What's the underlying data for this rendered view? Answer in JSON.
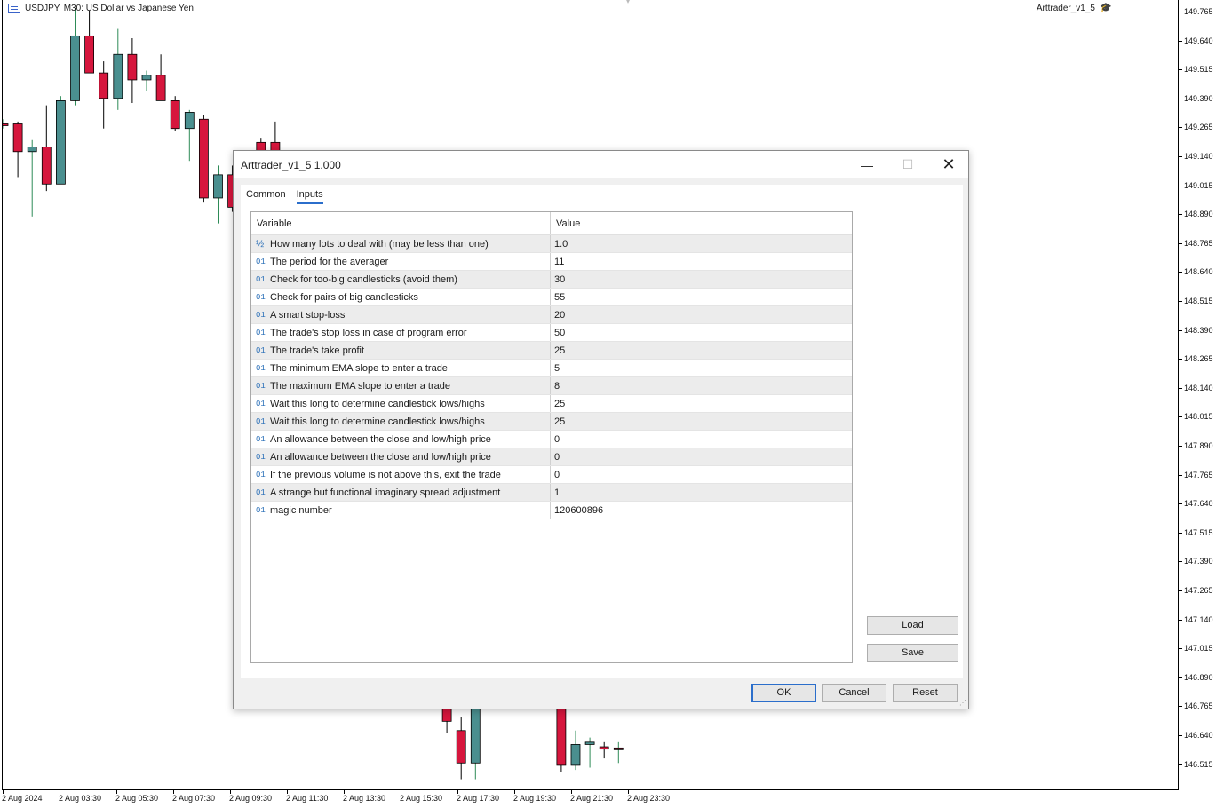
{
  "chart": {
    "symbol_text": "USDJPY, M30:  US Dollar vs Japanese Yen",
    "ea_name": "Arttrader_v1_5",
    "price_labels": [
      "149.765",
      "149.640",
      "149.515",
      "149.390",
      "149.265",
      "149.140",
      "149.015",
      "148.890",
      "148.765",
      "148.640",
      "148.515",
      "148.390",
      "148.265",
      "148.140",
      "148.015",
      "147.890",
      "147.765",
      "147.640",
      "147.515",
      "147.390",
      "147.265",
      "147.140",
      "147.015",
      "146.890",
      "146.765",
      "146.640",
      "146.515"
    ],
    "time_labels": [
      "2 Aug 2024",
      "2 Aug 03:30",
      "2 Aug 05:30",
      "2 Aug 07:30",
      "2 Aug 09:30",
      "2 Aug 11:30",
      "2 Aug 13:30",
      "2 Aug 15:30",
      "2 Aug 17:30",
      "2 Aug 19:30",
      "2 Aug 21:30",
      "2 Aug 23:30"
    ],
    "colors": {
      "bull": "#4a8f8f",
      "bear": "#d6163d",
      "bull_wick": "#2e8b57",
      "bear_wick": "#d6163d",
      "doji": "#2e8b57"
    }
  },
  "chart_data": {
    "type": "candlestick",
    "ylim": [
      146.45,
      149.8
    ],
    "candles": [
      {
        "i": 0,
        "o": 149.28,
        "h": 149.3,
        "l": 149.26,
        "c": 149.28
      },
      {
        "i": 1,
        "o": 149.28,
        "h": 149.29,
        "l": 149.05,
        "c": 149.16
      },
      {
        "i": 2,
        "o": 149.16,
        "h": 149.21,
        "l": 148.88,
        "c": 149.18
      },
      {
        "i": 3,
        "o": 149.18,
        "h": 149.36,
        "l": 148.99,
        "c": 149.02
      },
      {
        "i": 4,
        "o": 149.02,
        "h": 149.4,
        "l": 149.02,
        "c": 149.38
      },
      {
        "i": 5,
        "o": 149.38,
        "h": 149.78,
        "l": 149.36,
        "c": 149.66
      },
      {
        "i": 6,
        "o": 149.66,
        "h": 149.77,
        "l": 149.5,
        "c": 149.5
      },
      {
        "i": 7,
        "o": 149.5,
        "h": 149.55,
        "l": 149.26,
        "c": 149.39
      },
      {
        "i": 8,
        "o": 149.39,
        "h": 149.69,
        "l": 149.34,
        "c": 149.58
      },
      {
        "i": 9,
        "o": 149.58,
        "h": 149.65,
        "l": 149.37,
        "c": 149.47
      },
      {
        "i": 10,
        "o": 149.47,
        "h": 149.51,
        "l": 149.42,
        "c": 149.49
      },
      {
        "i": 11,
        "o": 149.49,
        "h": 149.58,
        "l": 149.38,
        "c": 149.38
      },
      {
        "i": 12,
        "o": 149.38,
        "h": 149.4,
        "l": 149.25,
        "c": 149.26
      },
      {
        "i": 13,
        "o": 149.26,
        "h": 149.34,
        "l": 149.12,
        "c": 149.33
      },
      {
        "i": 14,
        "o": 149.3,
        "h": 149.32,
        "l": 148.94,
        "c": 148.96
      },
      {
        "i": 15,
        "o": 148.96,
        "h": 149.1,
        "l": 148.85,
        "c": 149.06
      },
      {
        "i": 16,
        "o": 149.06,
        "h": 149.1,
        "l": 148.9,
        "c": 148.92
      },
      {
        "i": 17,
        "o": 148.92,
        "h": 149.0,
        "l": 148.9,
        "c": 148.96
      },
      {
        "i": 18,
        "o": 149.2,
        "h": 149.22,
        "l": 149.1,
        "c": 149.16
      },
      {
        "i": 19,
        "o": 149.2,
        "h": 149.29,
        "l": 149.14,
        "c": 149.16
      },
      {
        "i": 31,
        "o": 146.77,
        "h": 146.8,
        "l": 146.65,
        "c": 146.7
      },
      {
        "i": 32,
        "o": 146.66,
        "h": 146.72,
        "l": 146.45,
        "c": 146.52
      },
      {
        "i": 33,
        "o": 146.52,
        "h": 146.79,
        "l": 146.45,
        "c": 146.77
      },
      {
        "i": 39,
        "o": 146.77,
        "h": 146.8,
        "l": 146.48,
        "c": 146.51
      },
      {
        "i": 40,
        "o": 146.51,
        "h": 146.66,
        "l": 146.49,
        "c": 146.6
      },
      {
        "i": 41,
        "o": 146.6,
        "h": 146.63,
        "l": 146.5,
        "c": 146.61
      },
      {
        "i": 42,
        "o": 146.59,
        "h": 146.61,
        "l": 146.54,
        "c": 146.58
      },
      {
        "i": 43,
        "o": 146.585,
        "h": 146.61,
        "l": 146.52,
        "c": 146.585
      }
    ]
  },
  "dialog": {
    "title": "Arttrader_v1_5 1.000",
    "tabs": [
      {
        "label": "Common"
      },
      {
        "label": "Inputs"
      }
    ],
    "headers": {
      "variable": "Variable",
      "value": "Value"
    },
    "rows": [
      {
        "type": "½",
        "variable": "How many lots to deal with (may be less than one)",
        "value": "1.0"
      },
      {
        "type": "01",
        "variable": "The period for the averager",
        "value": "11"
      },
      {
        "type": "01",
        "variable": "Check for too-big candlesticks (avoid them)",
        "value": "30"
      },
      {
        "type": "01",
        "variable": "Check for pairs of big candlesticks",
        "value": "55"
      },
      {
        "type": "01",
        "variable": "A smart stop-loss",
        "value": "20"
      },
      {
        "type": "01",
        "variable": "The trade's stop loss in case of program error",
        "value": "50"
      },
      {
        "type": "01",
        "variable": "The trade's take profit",
        "value": "25"
      },
      {
        "type": "01",
        "variable": "The minimum EMA slope to enter a trade",
        "value": "5"
      },
      {
        "type": "01",
        "variable": "The maximum EMA slope to enter a trade",
        "value": "8"
      },
      {
        "type": "01",
        "variable": "Wait this long to determine candlestick lows/highs",
        "value": "25"
      },
      {
        "type": "01",
        "variable": "Wait this long to determine candlestick lows/highs",
        "value": "25"
      },
      {
        "type": "01",
        "variable": "An allowance between the close and low/high price",
        "value": "0"
      },
      {
        "type": "01",
        "variable": "An allowance between the close and low/high price",
        "value": "0"
      },
      {
        "type": "01",
        "variable": "If the previous volume is not above this, exit the trade",
        "value": "0"
      },
      {
        "type": "01",
        "variable": "A strange but functional imaginary spread adjustment",
        "value": "1"
      },
      {
        "type": "01",
        "variable": "magic number",
        "value": "120600896"
      }
    ],
    "buttons": {
      "load": "Load",
      "save": "Save",
      "ok": "OK",
      "cancel": "Cancel",
      "reset": "Reset"
    }
  }
}
